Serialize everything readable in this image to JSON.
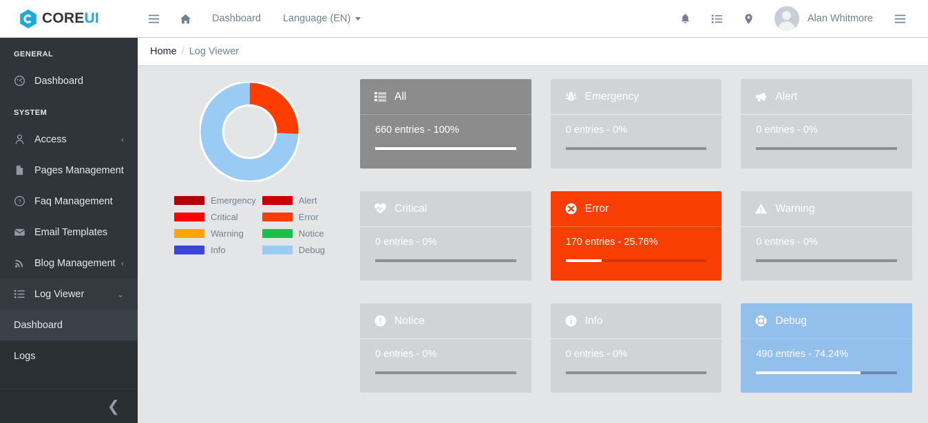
{
  "brand": {
    "name_part1": "CORE",
    "name_part2": "UI",
    "logo_icon": "coreui-hexagon-logo"
  },
  "header": {
    "menu_toggle_icon": "hamburger-menu-icon",
    "home_icon": "home-icon",
    "nav": [
      {
        "label": "Dashboard",
        "icon": ""
      },
      {
        "label": "Language (EN)",
        "icon": "chevron-down-icon",
        "has_caret": true
      }
    ],
    "right_icons": [
      {
        "name": "bell-icon"
      },
      {
        "name": "list-icon"
      },
      {
        "name": "location-pin-icon"
      }
    ],
    "user": {
      "name": "Alan Whitmore",
      "avatar_icon": "user-avatar-icon"
    },
    "aside_toggle_icon": "hamburger-menu-icon"
  },
  "sidebar": {
    "sections": [
      {
        "title": "GENERAL",
        "items": [
          {
            "label": "Dashboard",
            "icon": "speedometer-icon",
            "chevron": ""
          }
        ]
      },
      {
        "title": "SYSTEM",
        "items": [
          {
            "label": "Access",
            "icon": "user-icon",
            "chevron": "‹"
          },
          {
            "label": "Pages Management",
            "icon": "file-icon",
            "chevron": ""
          },
          {
            "label": "Faq Management",
            "icon": "question-circle-icon",
            "chevron": ""
          },
          {
            "label": "Email Templates",
            "icon": "envelope-icon",
            "chevron": ""
          },
          {
            "label": "Blog Management",
            "icon": "rss-icon",
            "chevron": "‹"
          },
          {
            "label": "Log Viewer",
            "icon": "list-icon",
            "chevron": "⌄",
            "active": true
          }
        ]
      }
    ],
    "sub_items": [
      {
        "label": "Dashboard",
        "active": true
      },
      {
        "label": "Logs",
        "active": false
      }
    ],
    "minimizer_icon": "chevron-left-icon"
  },
  "breadcrumb": {
    "home": "Home",
    "separator": "/",
    "current": "Log Viewer"
  },
  "chart_data": {
    "type": "pie",
    "title": "",
    "legend_position": "below",
    "categories": [
      "Emergency",
      "Alert",
      "Critical",
      "Error",
      "Warning",
      "Notice",
      "Info",
      "Debug"
    ],
    "values": [
      0,
      0,
      0,
      170,
      0,
      0,
      0,
      490
    ],
    "percentages": [
      0,
      0,
      0,
      25.76,
      0,
      0,
      0,
      74.24
    ],
    "colors": [
      "#b30000",
      "#cc0000",
      "#ff0000",
      "#ff3d00",
      "#ffa500",
      "#1bbf4c",
      "#3b46d6",
      "#9acbf5"
    ],
    "total": 660
  },
  "cards": [
    {
      "key": "all",
      "label": "All",
      "icon": "list-icon",
      "entries": "660 entries - 100%",
      "percent": 100,
      "style": "gray"
    },
    {
      "key": "emergency",
      "label": "Emergency",
      "icon": "bug-icon",
      "entries": "0 entries - 0%",
      "percent": 0,
      "style": "muted"
    },
    {
      "key": "alert",
      "label": "Alert",
      "icon": "bullhorn-icon",
      "entries": "0 entries - 0%",
      "percent": 0,
      "style": "muted"
    },
    {
      "key": "critical",
      "label": "Critical",
      "icon": "heart-pulse-icon",
      "entries": "0 entries - 0%",
      "percent": 0,
      "style": "muted"
    },
    {
      "key": "error",
      "label": "Error",
      "icon": "times-circle-icon",
      "entries": "170 entries - 25.76%",
      "percent": 25.76,
      "style": "error"
    },
    {
      "key": "warning",
      "label": "Warning",
      "icon": "warning-triangle-icon",
      "entries": "0 entries - 0%",
      "percent": 0,
      "style": "muted"
    },
    {
      "key": "notice",
      "label": "Notice",
      "icon": "exclamation-circle-icon",
      "entries": "0 entries - 0%",
      "percent": 0,
      "style": "muted"
    },
    {
      "key": "info",
      "label": "Info",
      "icon": "info-circle-icon",
      "entries": "0 entries - 0%",
      "percent": 0,
      "style": "muted"
    },
    {
      "key": "debug",
      "label": "Debug",
      "icon": "life-buoy-icon",
      "entries": "490 entries - 74.24%",
      "percent": 74.24,
      "style": "debug"
    }
  ],
  "colors": {
    "brand_blue": "#20a8d8",
    "sidebar_bg": "#2f353a",
    "content_bg": "#e4e5e6",
    "error": "#f93e03",
    "debug": "#93bfec",
    "muted_card": "#d1d3d5",
    "all_card": "#8c8c8c"
  }
}
